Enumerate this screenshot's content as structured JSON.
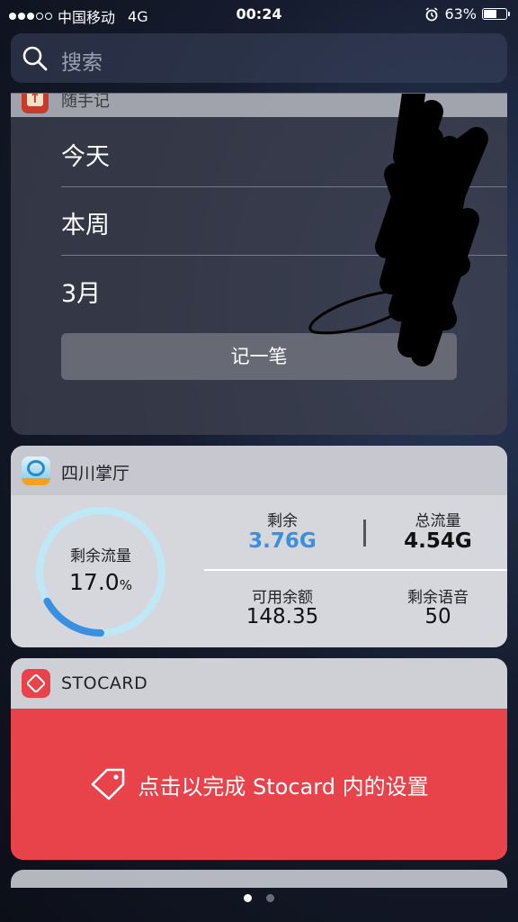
{
  "status_bar": {
    "carrier": "中国移动",
    "network": "4G",
    "time": "00:24",
    "battery_percent": "63%",
    "battery_level": 0.63,
    "signal_bars": 3,
    "signal_total": 5
  },
  "search": {
    "placeholder": "搜索"
  },
  "suishouji": {
    "title": "随手记",
    "rows": [
      "今天",
      "本周",
      "3月"
    ],
    "record_button": "记一笔"
  },
  "sichuan": {
    "title": "四川掌厅",
    "gauge_label": "剩余流量",
    "gauge_value": "17.0",
    "gauge_unit": "%",
    "gauge_fraction": 0.17,
    "remaining_label": "剩余",
    "remaining_value": "3.76G",
    "total_label": "总流量",
    "total_value": "4.54G",
    "balance_label": "可用余额",
    "balance_value": "148.35",
    "voice_label": "剩余语音",
    "voice_value": "50",
    "accent_color": "#3b8fe0"
  },
  "stocard": {
    "title": "STOCARD",
    "message": "点击以完成 Stocard 内的设置",
    "brand_color": "#e8424a"
  },
  "pager": {
    "pages": 2,
    "current": 0
  }
}
